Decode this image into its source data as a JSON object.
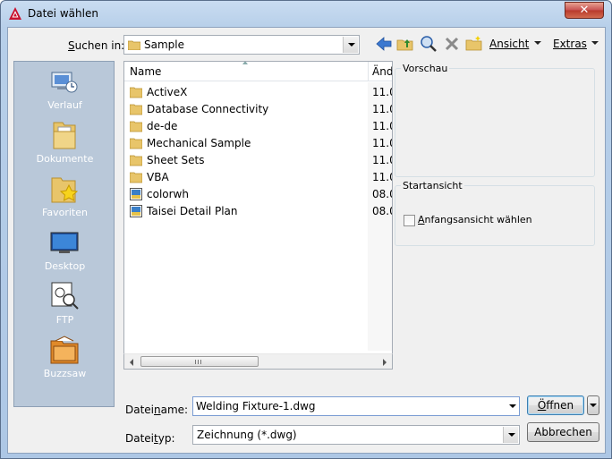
{
  "window": {
    "title": "Datei wählen",
    "close_glyph": "✕"
  },
  "toolbar": {
    "look_in_label_prefix": "S",
    "look_in_label_rest": "uchen in:",
    "look_in_value": "Sample",
    "view_label": "Ansicht",
    "tools_label": "Extras",
    "icons": [
      "back-arrow-icon",
      "up-folder-icon",
      "search-web-icon",
      "delete-icon",
      "new-folder-icon"
    ]
  },
  "places": [
    {
      "label": "Verlauf",
      "icon": "history-icon"
    },
    {
      "label": "Dokumente",
      "icon": "documents-icon"
    },
    {
      "label": "Favoriten",
      "icon": "favorites-icon"
    },
    {
      "label": "Desktop",
      "icon": "desktop-icon"
    },
    {
      "label": "FTP",
      "icon": "ftp-icon"
    },
    {
      "label": "Buzzsaw",
      "icon": "buzzsaw-icon"
    }
  ],
  "file_list": {
    "columns": [
      "Name",
      "Änd"
    ],
    "rows": [
      {
        "name": "ActiveX",
        "date": "11.0",
        "type": "folder"
      },
      {
        "name": "Database Connectivity",
        "date": "11.0",
        "type": "folder"
      },
      {
        "name": "de-de",
        "date": "11.0",
        "type": "folder"
      },
      {
        "name": "Mechanical Sample",
        "date": "11.0",
        "type": "folder"
      },
      {
        "name": "Sheet Sets",
        "date": "11.0",
        "type": "folder"
      },
      {
        "name": "VBA",
        "date": "11.0",
        "type": "folder"
      },
      {
        "name": "colorwh",
        "date": "08.0",
        "type": "dwg"
      },
      {
        "name": "Taisei Detail Plan",
        "date": "08.0",
        "type": "dwg"
      }
    ]
  },
  "preview": {
    "title": "Vorschau"
  },
  "initial_view": {
    "title": "Startansicht",
    "checkbox_prefix": "A",
    "checkbox_rest": "nfangsansicht wählen",
    "checked": false
  },
  "filename": {
    "label_prefix": "Datei",
    "label_u": "n",
    "label_rest": "ame:",
    "value": "Welding Fixture-1.dwg"
  },
  "filetype": {
    "label_prefix": "Datei",
    "label_u": "t",
    "label_rest": "yp:",
    "value": "Zeichnung (*.dwg)"
  },
  "buttons": {
    "open_u": "Ö",
    "open_rest": "ffnen",
    "cancel": "Abbrechen"
  },
  "colors": {
    "titlebar": "#b7cfe9",
    "places_bg": "#b9c8d9",
    "folder": "#e8c56a",
    "close": "#c75050"
  }
}
